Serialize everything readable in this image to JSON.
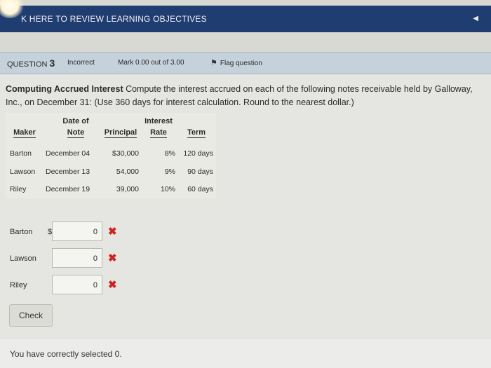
{
  "banner": {
    "text": "K HERE TO REVIEW LEARNING OBJECTIVES",
    "collapse_icon": "chevron-left-icon"
  },
  "question_bar": {
    "label_prefix": "QUESTION",
    "number": "3",
    "state": "Incorrect",
    "mark": "Mark 0.00 out of 3.00",
    "flag_label": "Flag question"
  },
  "question": {
    "title": "Computing Accrued Interest",
    "body": " Compute the interest accrued on each of the following notes receivable held by Galloway, Inc., on December 31: (Use 360 days for interest calculation. Round to the nearest dollar.)"
  },
  "table": {
    "headers": {
      "maker": "Maker",
      "date_line1": "Date of",
      "date_line2": "Note",
      "principal": "Principal",
      "rate_line1": "Interest",
      "rate_line2": "Rate",
      "term": "Term"
    },
    "rows": [
      {
        "maker": "Barton",
        "date": "December 04",
        "principal": "$30,000",
        "rate": "8%",
        "term": "120 days"
      },
      {
        "maker": "Lawson",
        "date": "December 13",
        "principal": "54,000",
        "rate": "9%",
        "term": "90 days"
      },
      {
        "maker": "Riley",
        "date": "December 19",
        "principal": "39,000",
        "rate": "10%",
        "term": "60 days"
      }
    ]
  },
  "answers": [
    {
      "label": "Barton",
      "currency": "$",
      "value": "0"
    },
    {
      "label": "Lawson",
      "currency": "",
      "value": "0"
    },
    {
      "label": "Riley",
      "currency": "",
      "value": "0"
    }
  ],
  "check_button": "Check",
  "feedback": "You have correctly selected 0.",
  "colors": {
    "banner": "#1f3d70",
    "incorrect_mark": "#d12020",
    "question_bar": "#c6d2db"
  }
}
